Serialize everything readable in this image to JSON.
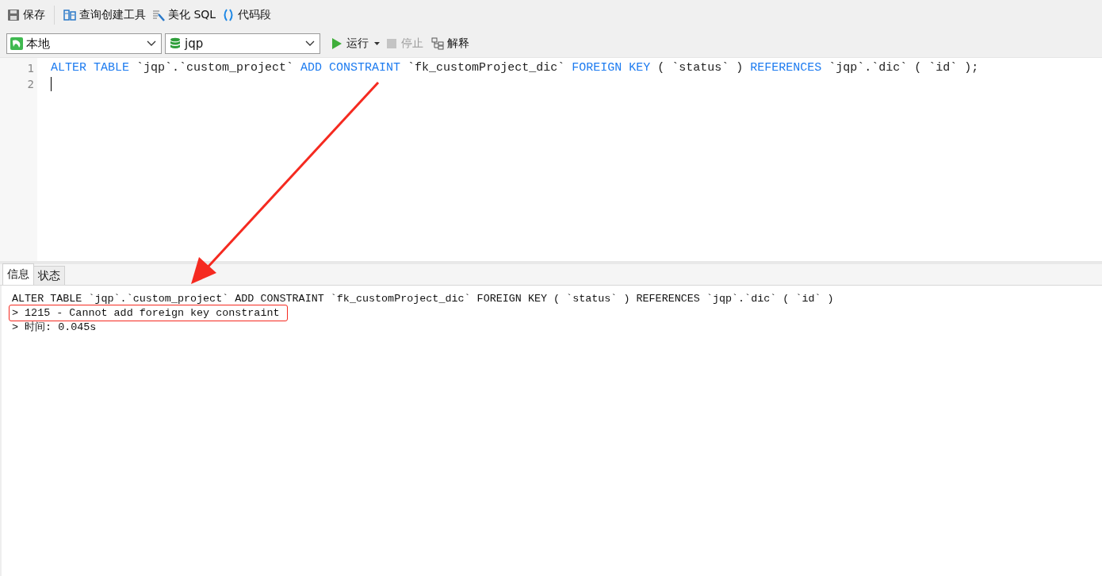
{
  "toolbar": {
    "items": [
      {
        "kind": "save",
        "label": "保存"
      },
      {
        "kind": "builder",
        "label": "查询创建工具"
      },
      {
        "kind": "beautify",
        "label": "美化 SQL"
      },
      {
        "kind": "snippet",
        "label": "代码段"
      }
    ]
  },
  "selectors": {
    "connection": "本地",
    "database": "jqp"
  },
  "actions": [
    {
      "kind": "run",
      "label": "运行",
      "disabled": false
    },
    {
      "kind": "stop",
      "label": "停止",
      "disabled": true
    },
    {
      "kind": "explain",
      "label": "解释",
      "disabled": false
    }
  ],
  "editor": {
    "lines": [
      {
        "number": "1",
        "tokens": [
          {
            "kind": "keyword",
            "text": "ALTER TABLE"
          },
          {
            "kind": "text",
            "text": "`jqp`.`custom_project`"
          },
          {
            "kind": "keyword",
            "text": "ADD CONSTRAINT"
          },
          {
            "kind": "text",
            "text": "`fk_customProject_dic`"
          },
          {
            "kind": "keyword",
            "text": "FOREIGN KEY"
          },
          {
            "kind": "text",
            "text": "( `status` )"
          },
          {
            "kind": "keyword",
            "text": "REFERENCES"
          },
          {
            "kind": "text",
            "text": "`jqp`.`dic` ( `id` );"
          }
        ]
      },
      {
        "number": "2",
        "cursor": true
      }
    ]
  },
  "result_tabs": [
    {
      "label": "信息",
      "selected": true
    },
    {
      "label": "状态",
      "selected": false
    }
  ],
  "messages": [
    {
      "text": "ALTER TABLE `jqp`.`custom_project` ADD CONSTRAINT `fk_customProject_dic` FOREIGN KEY ( `status` ) REFERENCES `jqp`.`dic` ( `id` )",
      "highlighted": false
    },
    {
      "text": "> 1215 - Cannot add foreign key constraint",
      "highlighted": true
    },
    {
      "text": "> 时间: 0.045s",
      "highlighted": false
    }
  ]
}
